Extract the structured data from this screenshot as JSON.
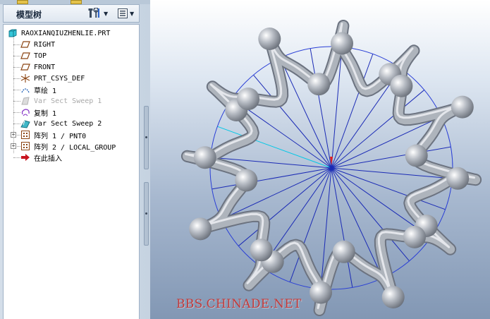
{
  "model_tree": {
    "title": "模型树",
    "settings_button": "tree-settings",
    "filters_button": "tree-filters"
  },
  "tree": {
    "items": [
      {
        "label": "RAOXIANQIUZHENLIE.PRT",
        "icon": "part-icon",
        "disabled": false
      },
      {
        "label": "RIGHT",
        "icon": "datum-plane-icon",
        "disabled": false
      },
      {
        "label": "TOP",
        "icon": "datum-plane-icon",
        "disabled": false
      },
      {
        "label": "FRONT",
        "icon": "datum-plane-icon",
        "disabled": false
      },
      {
        "label": "PRT_CSYS_DEF",
        "icon": "csys-icon",
        "disabled": false
      },
      {
        "label": "草绘 1",
        "icon": "sketch-icon",
        "disabled": false
      },
      {
        "label": "Var Sect Sweep 1",
        "icon": "sweep-icon",
        "disabled": true
      },
      {
        "label": "复制 1",
        "icon": "copy-icon",
        "disabled": false
      },
      {
        "label": "Var Sect Sweep 2",
        "icon": "sweep-icon",
        "disabled": false
      },
      {
        "label": "阵列 1 / PNT0",
        "icon": "pattern-icon",
        "disabled": false
      },
      {
        "label": "阵列 2 / LOCAL_GROUP",
        "icon": "pattern-icon",
        "disabled": false
      },
      {
        "label": "在此插入",
        "icon": "insert-arrow-icon",
        "disabled": false
      }
    ]
  },
  "viewport": {
    "watermark": "BBS.CHINADE.NET",
    "colors": {
      "circle": "#2a3fd6",
      "spokes": "#1a2ab5",
      "highlight_spoke": "#00c8e6",
      "tube": "#aeb4bc",
      "center_marker": "#e02020"
    }
  }
}
